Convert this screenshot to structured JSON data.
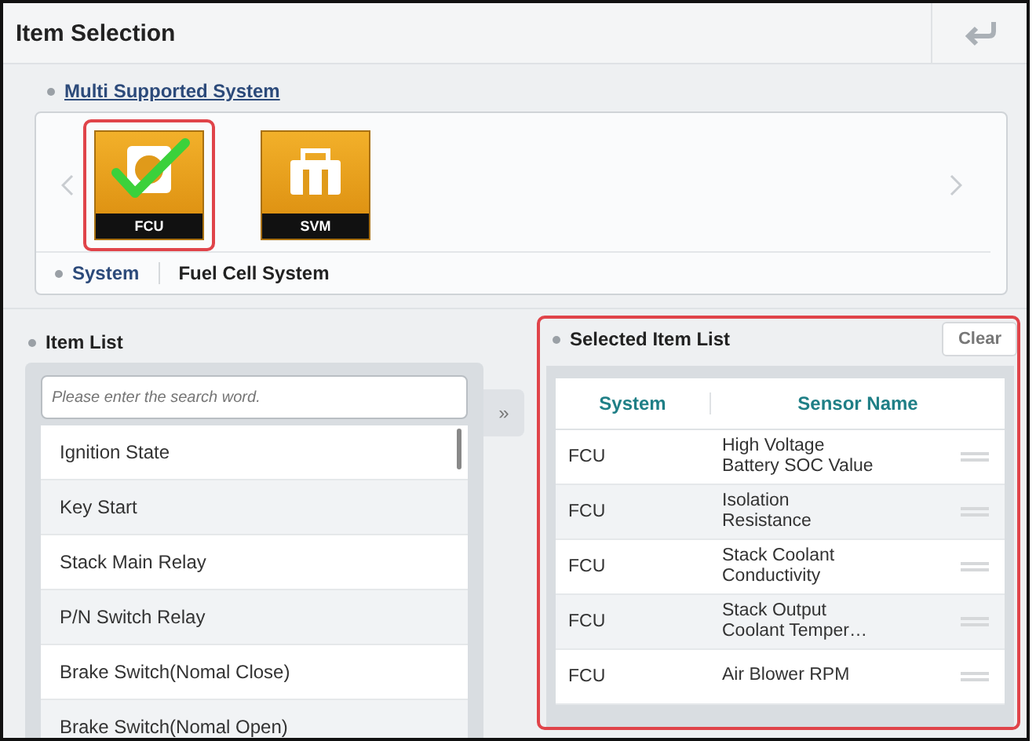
{
  "window": {
    "title": "Item Selection"
  },
  "multi_supported_system": {
    "label": "Multi Supported System",
    "systems": [
      {
        "label": "FCU",
        "selected": true
      },
      {
        "label": "SVM",
        "selected": false
      }
    ]
  },
  "system": {
    "label": "System",
    "value": "Fuel Cell System"
  },
  "item_list": {
    "label": "Item List",
    "search": {
      "placeholder": "Please enter the search word."
    },
    "items": [
      "Ignition State",
      "Key Start",
      "Stack Main Relay",
      "P/N Switch Relay",
      "Brake Switch(Nomal Close)",
      "Brake Switch(Nomal Open)"
    ]
  },
  "move_button": "»",
  "selected_item_list": {
    "label": "Selected Item List",
    "clear": "Clear",
    "columns": [
      "System",
      "Sensor Name"
    ],
    "rows": [
      {
        "system": "FCU",
        "sensor": "High Voltage Battery SOC Value"
      },
      {
        "system": "FCU",
        "sensor": "Isolation Resistance"
      },
      {
        "system": "FCU",
        "sensor": "Stack Coolant Conductivity"
      },
      {
        "system": "FCU",
        "sensor": "Stack Output Coolant Temper…"
      },
      {
        "system": "FCU",
        "sensor": "Air Blower RPM"
      }
    ]
  }
}
